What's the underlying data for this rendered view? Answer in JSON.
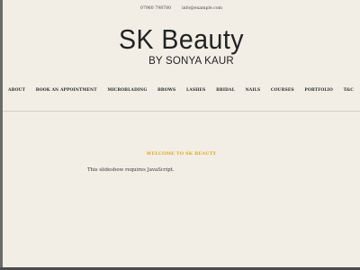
{
  "topbar": {
    "phone": "07960 798780",
    "email": "info@example.com"
  },
  "logo": {
    "title": "SK Beauty",
    "subtitle": "BY SONYA KAUR"
  },
  "nav": {
    "items": [
      {
        "label": "ABOUT"
      },
      {
        "label": "BOOK AN APPOINTMENT"
      },
      {
        "label": "MICROBLADING"
      },
      {
        "label": "BROWS"
      },
      {
        "label": "LASHES"
      },
      {
        "label": "BRIDAL"
      },
      {
        "label": "NAILS"
      },
      {
        "label": "COURSES"
      },
      {
        "label": "PORTFOLIO"
      },
      {
        "label": "T&C"
      }
    ]
  },
  "main": {
    "heading": "WELCOME TO SK BEAUTY",
    "slideshow_message": "This slideshow requires JavaScript."
  },
  "colors": {
    "background": "#f2eee6",
    "accent": "#e8a51f",
    "text": "#222222"
  }
}
